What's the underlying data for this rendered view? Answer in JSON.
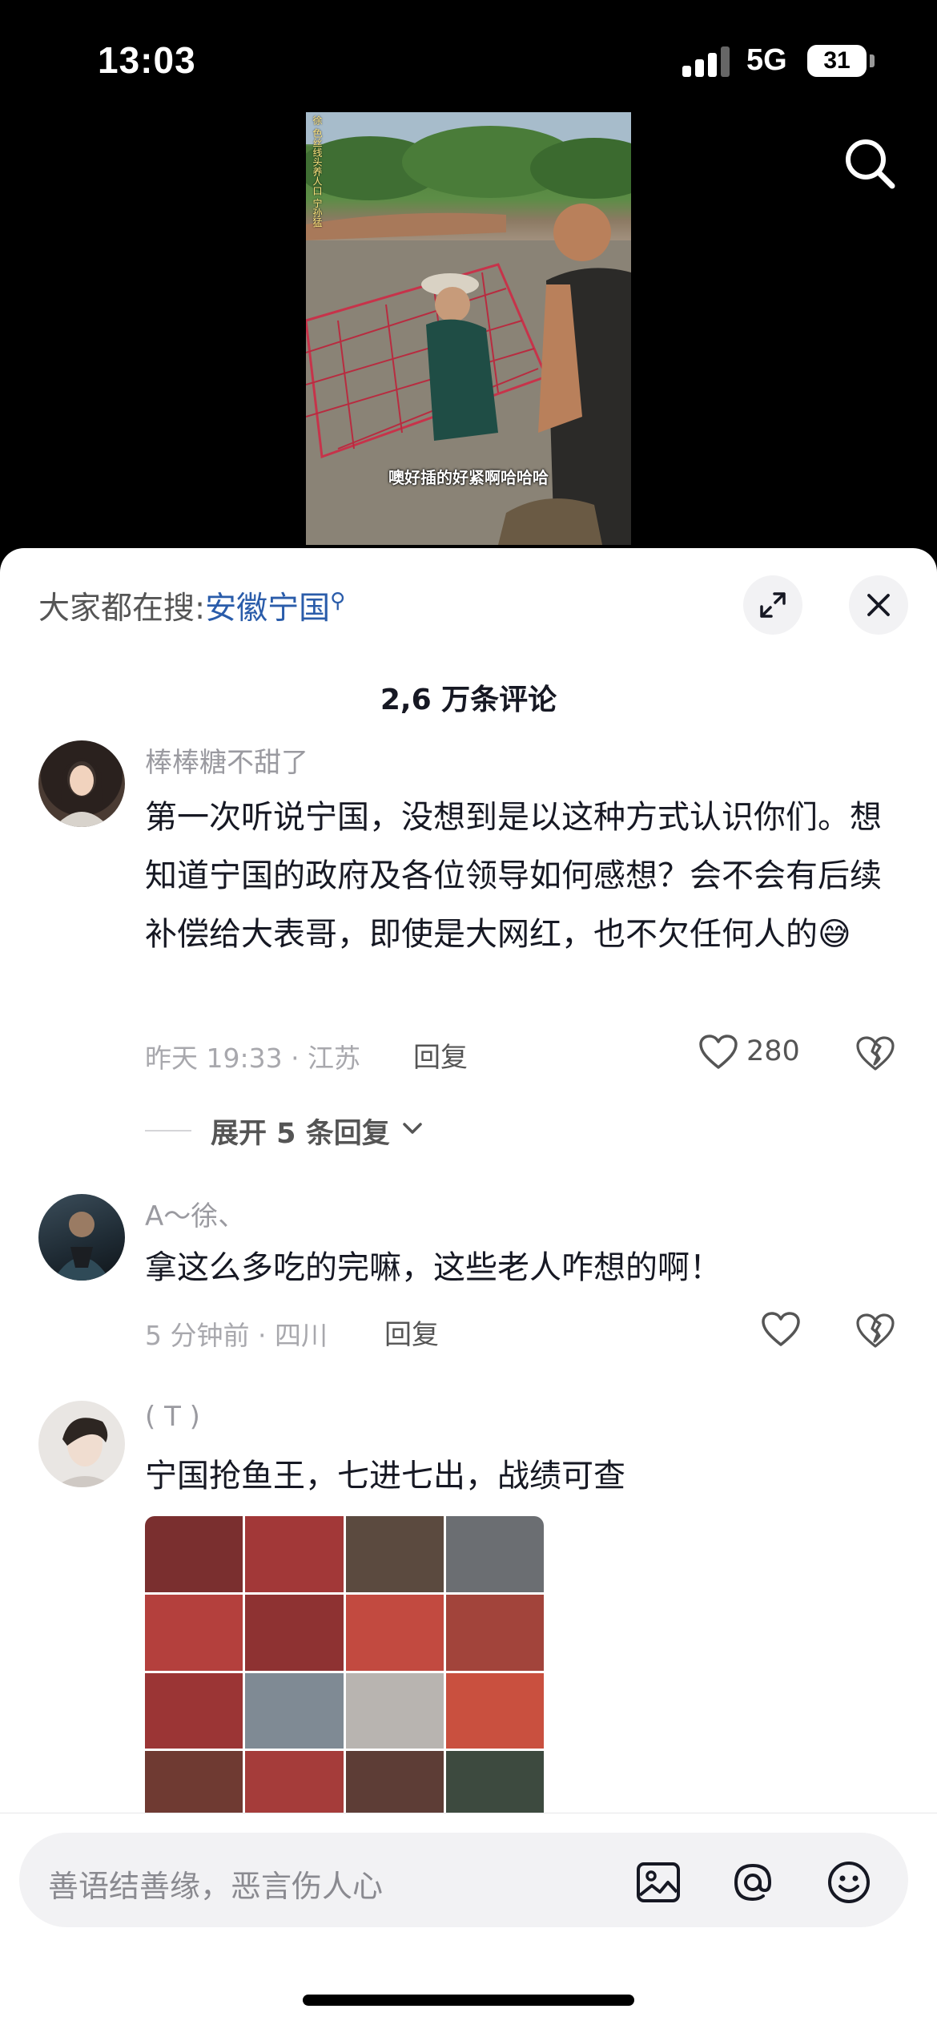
{
  "status_bar": {
    "time": "13:03",
    "network": "5G",
    "battery": "31"
  },
  "video": {
    "caption": "噢好插的好紧啊哈哈哈",
    "side_text": "徐 色丝线头养人口 宁孙猛"
  },
  "panel": {
    "search_hint_prefix": "大家都在搜:",
    "search_hint_keyword": "安徽宁国",
    "comment_count": "2,6 万条评论"
  },
  "comments": [
    {
      "user": "棒棒糖不甜了",
      "text": "第一次听说宁国，没想到是以这种方式认识你们。想知道宁国的政府及各位领导如何感想？会不会有后续补偿给大表哥，即使是大网红，也不欠任何人的😅",
      "meta": "昨天 19:33 · 江苏",
      "reply_label": "回复",
      "likes": "280",
      "expand_replies": "展开 5 条回复"
    },
    {
      "user": "A～徐、",
      "text": "拿这么多吃的完嘛，这些老人咋想的啊！",
      "meta": "5 分钟前 · 四川",
      "reply_label": "回复"
    },
    {
      "user": "( T )",
      "text": "宁国抢鱼王，七进七出，战绩可查"
    }
  ],
  "input_bar": {
    "placeholder": "善语结善缘，恶言伤人心"
  },
  "icons": {
    "search": "search-icon",
    "expand": "expand-icon",
    "close": "close-icon",
    "heart": "heart-icon",
    "dislike": "broken-heart-icon",
    "chevron": "chevron-down-icon",
    "image": "image-icon",
    "mention": "at-sign-icon",
    "emoji": "emoji-icon"
  },
  "colors": {
    "keyword": "#2a5caa",
    "muted_text": "#9a9aa0",
    "panel_bg": "#ffffff",
    "input_bg": "#f2f2f4"
  }
}
